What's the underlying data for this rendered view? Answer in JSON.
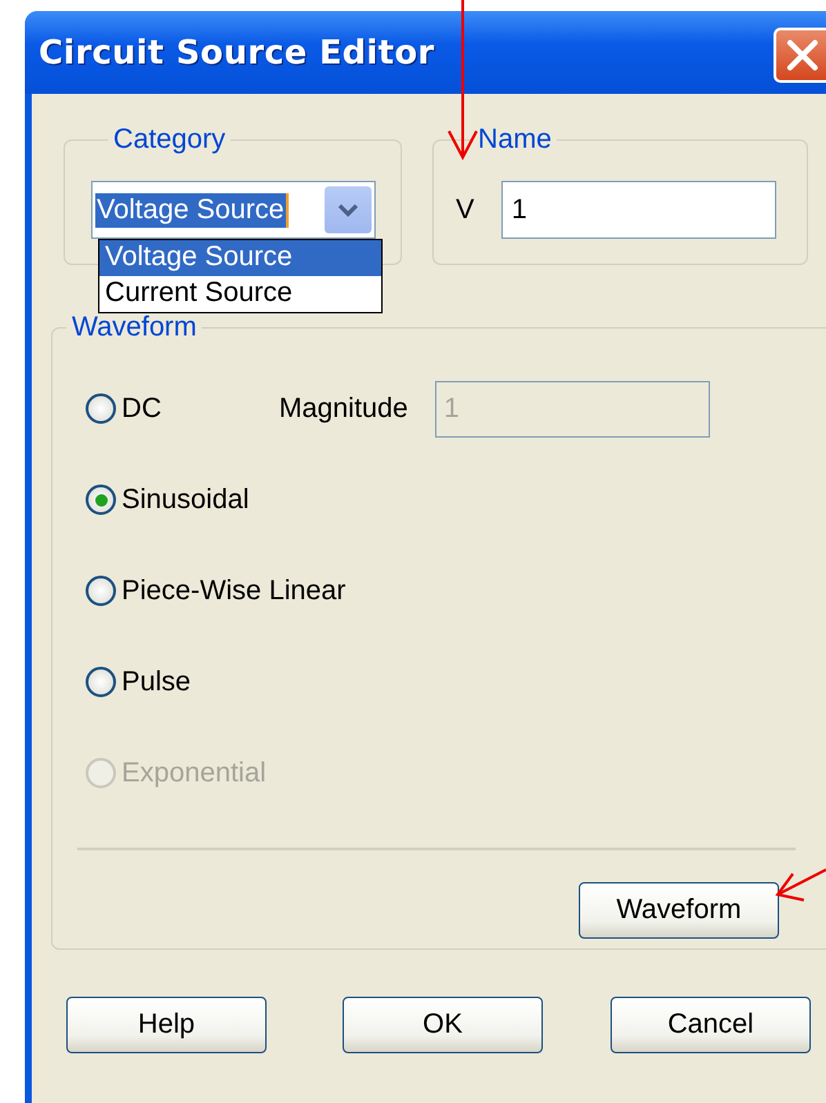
{
  "window": {
    "title": "Circuit Source Editor"
  },
  "category": {
    "label": "Category",
    "value": "Voltage Source",
    "expanded": true,
    "options": [
      {
        "label": "Voltage Source",
        "selected": true
      },
      {
        "label": "Current Source",
        "selected": false
      }
    ]
  },
  "name": {
    "label": "Name",
    "prefix": "V",
    "value": "1"
  },
  "waveform": {
    "label": "Waveform",
    "options": [
      {
        "label": "DC",
        "selected": false,
        "disabled": false
      },
      {
        "label": "Sinusoidal",
        "selected": true,
        "disabled": false
      },
      {
        "label": "Piece-Wise Linear",
        "selected": false,
        "disabled": false
      },
      {
        "label": "Pulse",
        "selected": false,
        "disabled": false
      },
      {
        "label": "Exponential",
        "selected": false,
        "disabled": true
      }
    ],
    "magnitude": {
      "label": "Magnitude",
      "value": "1",
      "disabled": true
    },
    "button": "Waveform"
  },
  "buttons": [
    "Help",
    "OK",
    "Cancel"
  ]
}
